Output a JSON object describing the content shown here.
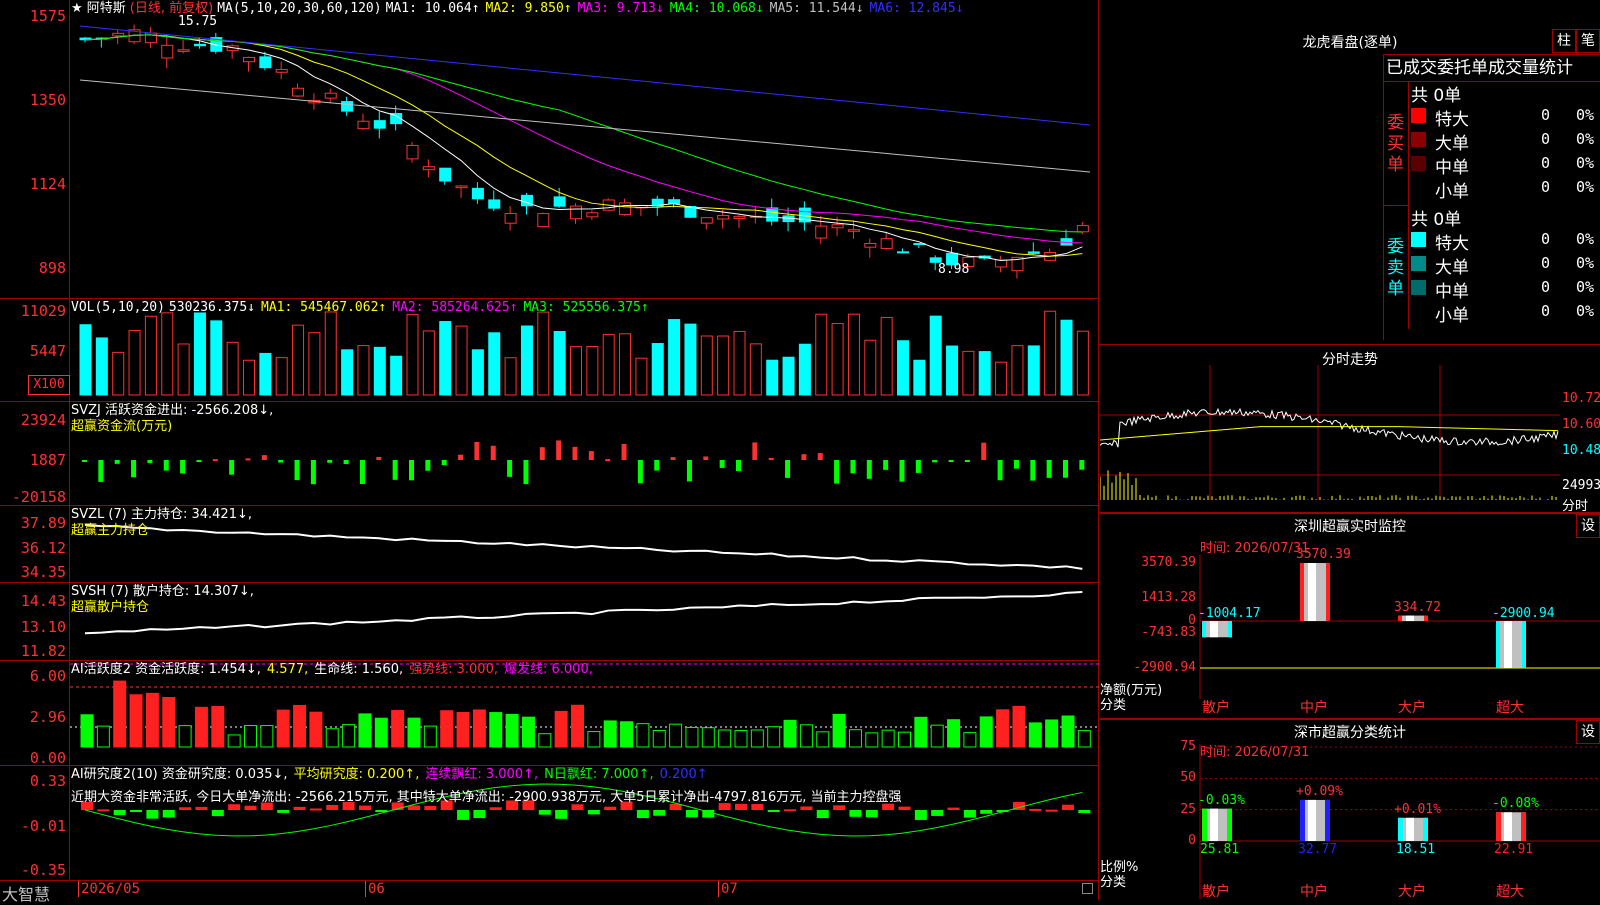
{
  "kline": {
    "axis": [
      "1575",
      "1350",
      "1124",
      "898"
    ],
    "title": "★ 阿特斯",
    "mode": "(日线, 前复权)",
    "ma_label": "MA(5,10,20,30,60,120)",
    "ma": [
      {
        "label": "MA1: 10.064↑",
        "color": "#ffffff"
      },
      {
        "label": "MA2: 9.850↑",
        "color": "#ffff00"
      },
      {
        "label": "MA3: 9.713↓",
        "color": "#ff00ff"
      },
      {
        "label": "MA4: 10.068↓",
        "color": "#00ff00"
      },
      {
        "label": "MA5: 11.544↓",
        "color": "#c0c0c0"
      },
      {
        "label": "MA6: 12.845↓",
        "color": "#3030ff"
      }
    ],
    "high_label": "15.75",
    "low_label": "8.98"
  },
  "vol": {
    "axis": [
      "11029",
      "5447"
    ],
    "unit": "X100",
    "title": "VOL(5,10,20)",
    "values": [
      {
        "label": "530236.375↓",
        "color": "#ffffff"
      },
      {
        "label": "MA1: 545467.062↑",
        "color": "#ffff00"
      },
      {
        "label": "MA2: 585264.625↑",
        "color": "#ff00ff"
      },
      {
        "label": "MA3: 525556.375↑",
        "color": "#00ff00"
      }
    ]
  },
  "svzj": {
    "axis": [
      "23924",
      "1887",
      "-20158"
    ],
    "title": "SVZJ  活跃资金进出: -2566.208↓,",
    "sub": "超赢资金流(万元)"
  },
  "svzl": {
    "axis": [
      "37.89",
      "36.12",
      "34.35"
    ],
    "title": "SVZL (7) 主力持仓: 34.421↓,",
    "sub": "超赢主力持仓"
  },
  "svsh": {
    "axis": [
      "14.43",
      "13.10",
      "11.82"
    ],
    "title": "SVSH (7) 散户持仓: 14.307↓,",
    "sub": "超赢散户持仓"
  },
  "ai1": {
    "axis": [
      "6.00",
      "2.96",
      "0.00"
    ],
    "parts": [
      {
        "label": "AI活跃度2 资金活跃度: 1.454↓,",
        "color": "#ffffff"
      },
      {
        "label": "4.577,",
        "color": "#ffff00"
      },
      {
        "label": "生命线: 1.560,",
        "color": "#ffffff"
      },
      {
        "label": "强势线: 3.000,",
        "color": "#ff3030"
      },
      {
        "label": "爆发线: 6.000,",
        "color": "#ff00ff"
      }
    ]
  },
  "ai2": {
    "axis": [
      "0.33",
      "-0.01",
      "-0.35"
    ],
    "parts": [
      {
        "label": "AI研究度2(10) 资金研究度: 0.035↓,",
        "color": "#ffffff"
      },
      {
        "label": "平均研究度: 0.200↑,",
        "color": "#ffff00"
      },
      {
        "label": "连续飘红: 3.000↑,",
        "color": "#ff00ff"
      },
      {
        "label": "N日飘红: 7.000↑,",
        "color": "#00ff00"
      },
      {
        "label": "0.200↑",
        "color": "#3030ff"
      }
    ],
    "note": "近期大资金非常活跃, 今日大单净流出: -2566.215万元, 其中特大单净流出: -2900.938万元, 大单5日累计净出-4797.816万元, 当前主力控盘强"
  },
  "bottom": {
    "brand": "大智慧",
    "dates": [
      "2026/05",
      "06",
      "07"
    ]
  },
  "lhb": {
    "title": "龙虎看盘(逐单)",
    "btn1": "柱",
    "btn2": "笔",
    "subtitle": "已成交委托单成交量统计",
    "buy": {
      "side": "委买单",
      "count": "共 0单",
      "rows": [
        {
          "name": "特大",
          "v": "0",
          "p": "0%",
          "color": "#ff0000"
        },
        {
          "name": "大单",
          "v": "0",
          "p": "0%",
          "color": "#8b0000"
        },
        {
          "name": "中单",
          "v": "0",
          "p": "0%",
          "color": "#5a0000"
        },
        {
          "name": "小单",
          "v": "0",
          "p": "0%",
          "color": "#000000"
        }
      ]
    },
    "sell": {
      "side": "委卖单",
      "count": "共 0单",
      "rows": [
        {
          "name": "特大",
          "v": "0",
          "p": "0%",
          "color": "#00ffff"
        },
        {
          "name": "大单",
          "v": "0",
          "p": "0%",
          "color": "#008b8b"
        },
        {
          "name": "中单",
          "v": "0",
          "p": "0%",
          "color": "#006b6b"
        },
        {
          "name": "小单",
          "v": "0",
          "p": "0%",
          "color": "#000000"
        }
      ]
    }
  },
  "fenshi": {
    "title": "分时走势",
    "axis": [
      "10.72",
      "10.60",
      "10.48"
    ],
    "vol_label": "24993",
    "tag": "分时"
  },
  "monitor": {
    "title": "深圳超赢实时监控",
    "btn": "设",
    "time": "时间: 2026/07/31",
    "axis": [
      "3570.39",
      "1413.28",
      "0",
      "-743.83",
      "-2900.94"
    ],
    "ylabel": "净额(万元)",
    "xlabel": "分类",
    "categories": [
      "散户",
      "中户",
      "大户",
      "超大"
    ],
    "values": [
      -1004.17,
      3570.39,
      334.72,
      -2900.94
    ],
    "value_labels": [
      "-1004.17",
      "3570.39",
      "334.72",
      "-2900.94"
    ]
  },
  "classify": {
    "title": "深市超赢分类统计",
    "btn": "设",
    "time": "时间: 2026/07/31",
    "axis": [
      "75",
      "50",
      "25",
      "0"
    ],
    "ylabel": "比例%",
    "xlabel": "分类",
    "categories": [
      "散户",
      "中户",
      "大户",
      "超大"
    ],
    "values": [
      25.81,
      32.77,
      18.51,
      22.91
    ],
    "value_labels": [
      "25.81",
      "32.77",
      "18.51",
      "22.91"
    ],
    "change_labels": [
      "-0.03%",
      "+0.09%",
      "+0.01%",
      "-0.08%"
    ],
    "colors": [
      "#00ff00",
      "#2020ff",
      "#00ffff",
      "#ff2020"
    ]
  }
}
